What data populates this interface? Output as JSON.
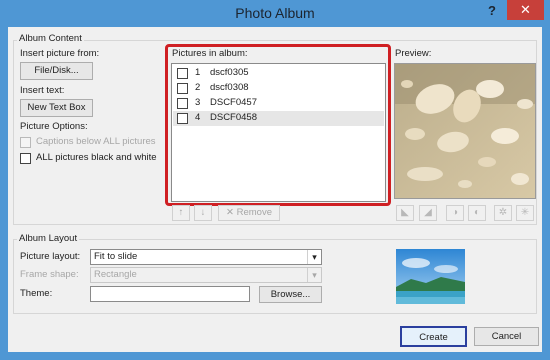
{
  "window": {
    "title": "Photo Album",
    "help": "?",
    "close": "✕"
  },
  "album_content": {
    "group_label": "Album Content",
    "insert_picture_label": "Insert picture from:",
    "file_disk_button": "File/Disk...",
    "insert_text_label": "Insert text:",
    "new_textbox_button": "New Text Box",
    "picture_options_label": "Picture Options:",
    "captions_option": "Captions below ALL pictures",
    "bw_option": "ALL pictures black and white"
  },
  "pictures": {
    "label": "Pictures in album:",
    "items": [
      {
        "num": "1",
        "name": "dscf0305"
      },
      {
        "num": "2",
        "name": "dscf0308"
      },
      {
        "num": "3",
        "name": "DSCF0457"
      },
      {
        "num": "4",
        "name": "DSCF0458"
      }
    ],
    "selected_index": 3,
    "move_up": "↑",
    "move_down": "↓",
    "remove_button": "Remove"
  },
  "preview": {
    "label": "Preview:"
  },
  "album_layout": {
    "group_label": "Album Layout",
    "picture_layout_label": "Picture layout:",
    "picture_layout_value": "Fit to slide",
    "frame_shape_label": "Frame shape:",
    "frame_shape_value": "Rectangle",
    "theme_label": "Theme:",
    "theme_value": "",
    "browse_button": "Browse..."
  },
  "footer": {
    "create_button": "Create",
    "cancel_button": "Cancel"
  },
  "colors": {
    "titlebar": "#4f97d4",
    "close": "#c7403a",
    "highlight": "#cf1f23",
    "default_button_border": "#2b3f9e"
  },
  "icons": [
    "help-icon",
    "close-icon",
    "arrow-up-icon",
    "arrow-down-icon",
    "remove-x-icon",
    "rotate-left-icon",
    "rotate-right-icon",
    "contrast-up-icon",
    "contrast-down-icon",
    "brightness-up-icon",
    "brightness-down-icon",
    "chevron-down-icon"
  ]
}
